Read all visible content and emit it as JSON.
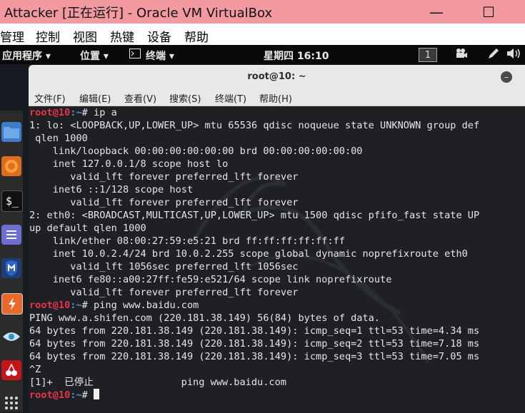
{
  "host": {
    "title": "Attacker [正在运行] - Oracle VM VirtualBox",
    "minimize_glyph": "—",
    "maximize_glyph": "☐",
    "menu": [
      "管理",
      "控制",
      "视图",
      "热键",
      "设备",
      "帮助"
    ]
  },
  "panel": {
    "applications": "应用程序 ▾",
    "places": "位置 ▾",
    "terminal_app": "终端 ▾",
    "clock": "星期四 16:10",
    "workspace": "1"
  },
  "terminal": {
    "title": "root@10: ~",
    "menu": [
      "文件(F)",
      "编辑(E)",
      "查看(V)",
      "搜索(S)",
      "终端(T)",
      "帮助(H)"
    ],
    "prompt_user": "root@10",
    "prompt_path": ":~",
    "prompt_suffix": "# ",
    "commands": {
      "ip": "ip a",
      "ping": "ping www.baidu.com"
    },
    "output": [
      "1: lo: <LOOPBACK,UP,LOWER_UP> mtu 65536 qdisc noqueue state UNKNOWN group def",
      " qlen 1000",
      "    link/loopback 00:00:00:00:00:00 brd 00:00:00:00:00:00",
      "    inet 127.0.0.1/8 scope host lo",
      "       valid_lft forever preferred_lft forever",
      "    inet6 ::1/128 scope host",
      "       valid_lft forever preferred_lft forever",
      "2: eth0: <BROADCAST,MULTICAST,UP,LOWER_UP> mtu 1500 qdisc pfifo_fast state UP",
      "up default qlen 1000",
      "    link/ether 08:00:27:59:e5:21 brd ff:ff:ff:ff:ff:ff",
      "    inet 10.0.2.4/24 brd 10.0.2.255 scope global dynamic noprefixroute eth0",
      "       valid_lft 1056sec preferred_lft 1056sec",
      "    inet6 fe80::a00:27ff:fe59:e521/64 scope link noprefixroute",
      "       valid_lft forever preferred_lft forever"
    ],
    "ping_output": [
      "PING www.a.shifen.com (220.181.38.149) 56(84) bytes of data.",
      "64 bytes from 220.181.38.149 (220.181.38.149): icmp_seq=1 ttl=53 time=4.34 ms",
      "64 bytes from 220.181.38.149 (220.181.38.149): icmp_seq=2 ttl=53 time=7.18 ms",
      "64 bytes from 220.181.38.149 (220.181.38.149): icmp_seq=3 ttl=53 time=7.05 ms",
      "^Z",
      "[1]+  已停止               ping www.baidu.com"
    ]
  },
  "colors": {
    "host_titlebar": "#f29aa0",
    "prompt_user": "#e8344a",
    "prompt_path": "#5b8fd6",
    "terminal_bg": "#1e2024"
  },
  "dock_icons": [
    "files-icon",
    "firefox-icon",
    "terminal-icon",
    "notes-icon",
    "metasploit-icon",
    "burpsuite-icon",
    "eye-icon",
    "cherrytree-icon",
    "show-apps-icon"
  ]
}
